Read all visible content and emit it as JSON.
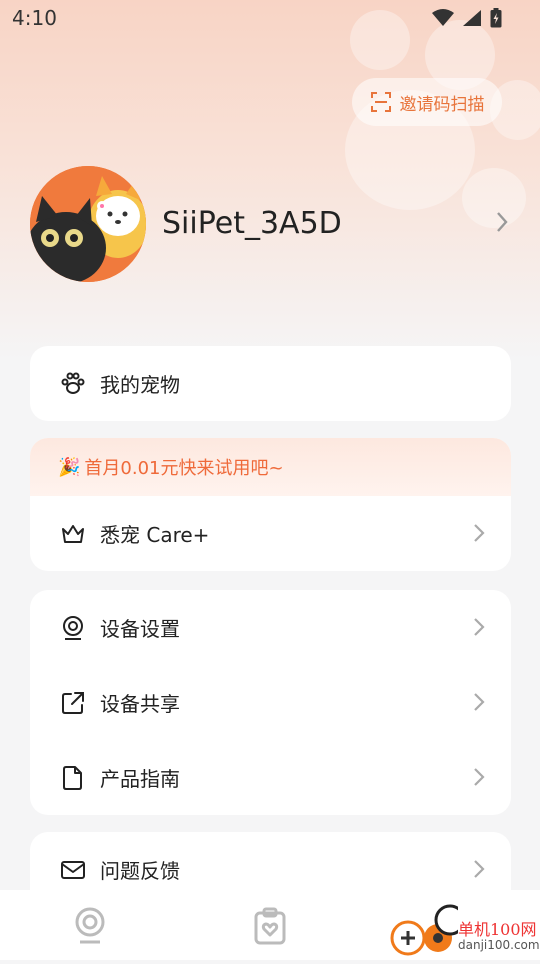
{
  "status_bar": {
    "time": "4:10"
  },
  "header": {
    "scan_button_label": "邀请码扫描",
    "username": "SiiPet_3A5D"
  },
  "menu": {
    "pets_label": "我的宠物",
    "promo_text": "首月0.01元快来试用吧~",
    "care_label": "悉宠 Care+",
    "device_settings_label": "设备设置",
    "device_share_label": "设备共享",
    "product_guide_label": "产品指南",
    "feedback_label": "问题反馈"
  },
  "watermark": {
    "line1": "单机100网",
    "line2": "danji100.com"
  },
  "colors": {
    "accent": "#ef6a3a",
    "text": "#222222",
    "background": "#f5f5f6"
  }
}
